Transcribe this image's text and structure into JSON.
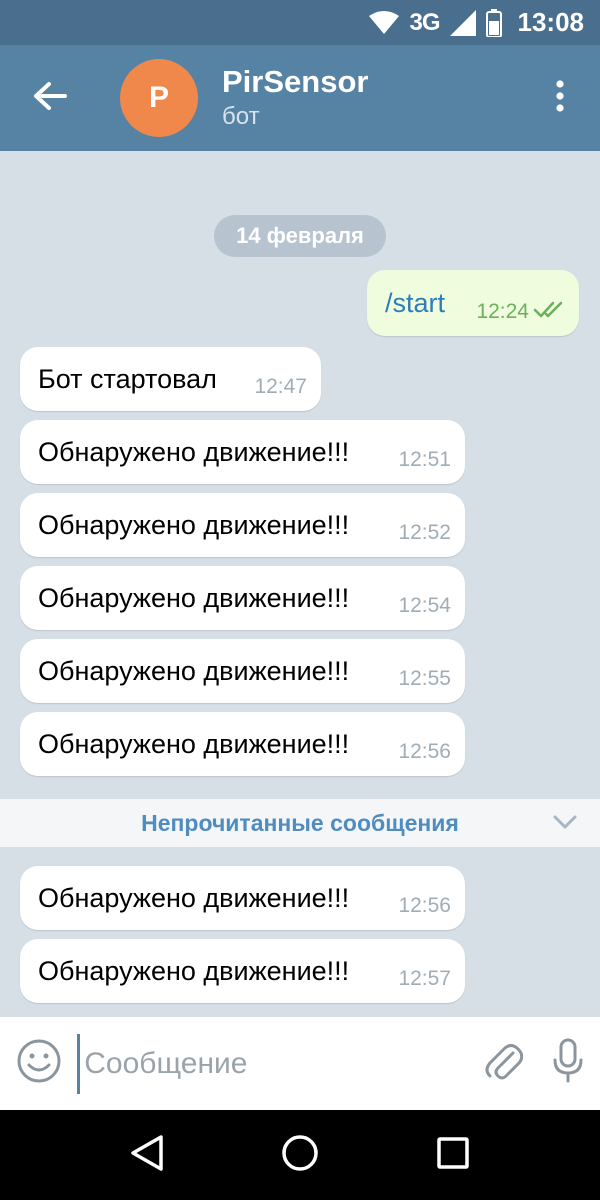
{
  "status_bar": {
    "network": "3G",
    "time": "13:08"
  },
  "header": {
    "avatar_letter": "P",
    "title": "PirSensor",
    "subtitle": "бот",
    "avatar_color": "#f0884b"
  },
  "chat": {
    "date_label": "14 февраля",
    "messages": [
      {
        "direction": "out",
        "text": "/start",
        "time": "12:24",
        "status": "read"
      },
      {
        "direction": "in",
        "text": "Бот стартовал",
        "time": "12:47"
      },
      {
        "direction": "in",
        "text": "Обнаружено движение!!!",
        "time": "12:51"
      },
      {
        "direction": "in",
        "text": "Обнаружено движение!!!",
        "time": "12:52"
      },
      {
        "direction": "in",
        "text": "Обнаружено движение!!!",
        "time": "12:54"
      },
      {
        "direction": "in",
        "text": "Обнаружено движение!!!",
        "time": "12:55"
      },
      {
        "direction": "in",
        "text": "Обнаружено движение!!!",
        "time": "12:56"
      },
      {
        "direction": "in",
        "text": "Обнаружено движение!!!",
        "time": "12:56"
      },
      {
        "direction": "in",
        "text": "Обнаружено движение!!!",
        "time": "12:57"
      }
    ],
    "unread_label": "Непрочитанные сообщения"
  },
  "composer": {
    "placeholder": "Сообщение"
  },
  "colors": {
    "header": "#5682a3",
    "status_bar": "#4a6f8e",
    "chat_bg": "#d6dee6",
    "outgoing_bubble": "#effdde",
    "accent_text": "#2e7cb8"
  },
  "icons": {
    "back": "arrow-left-icon",
    "menu": "more-vertical-icon",
    "emoji": "smile-icon",
    "attach": "paperclip-icon",
    "mic": "microphone-icon",
    "unread": "chevron-down-icon",
    "nav_back": "triangle-back-icon",
    "nav_home": "circle-home-icon",
    "nav_recent": "square-recent-icon"
  }
}
